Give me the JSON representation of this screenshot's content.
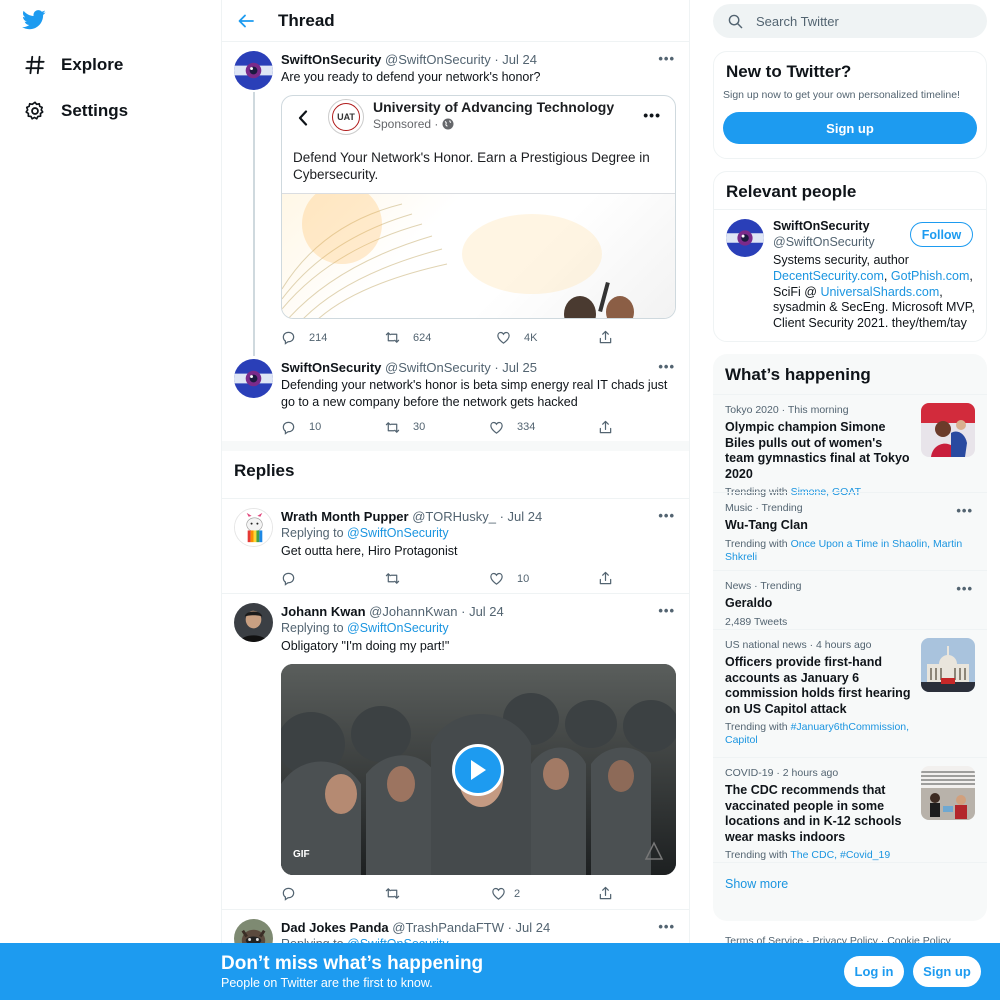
{
  "nav": {
    "explore": "Explore",
    "settings": "Settings"
  },
  "header": {
    "title": "Thread"
  },
  "main_tweet": {
    "name": "SwiftOnSecurity",
    "handle": "@SwiftOnSecurity",
    "date": "· Jul 24",
    "text": "Are you ready to defend your network's honor?",
    "card": {
      "advertiser": "University of Advancing Technology",
      "sponsored": "Sponsored ·",
      "logo_text": "UAT",
      "body": "Defend Your Network's Honor. Earn a Prestigious Degree in Cybersecurity."
    },
    "replies": "214",
    "retweets": "624",
    "likes": "4K"
  },
  "second_tweet": {
    "name": "SwiftOnSecurity",
    "handle": "@SwiftOnSecurity",
    "date": "· Jul 25",
    "text": "Defending your network's honor is beta simp energy real IT chads just go to a new company before the network gets hacked",
    "replies": "10",
    "retweets": "30",
    "likes": "334"
  },
  "replies_title": "Replies",
  "replies": [
    {
      "name": "Wrath Month Pupper",
      "handle": "@TORHusky_",
      "date": "· Jul 24",
      "replying_label": "Replying to",
      "replying_to": "@SwiftOnSecurity",
      "text": "Get outta here, Hiro Protagonist",
      "replies": "",
      "retweets": "",
      "likes": "10"
    },
    {
      "name": "Johann Kwan",
      "handle": "@JohannKwan",
      "date": "· Jul 24",
      "replying_label": "Replying to",
      "replying_to": "@SwiftOnSecurity",
      "text": "Obligatory \"I'm doing my part!\"",
      "gif_label": "GIF",
      "replies": "",
      "retweets": "",
      "likes": "2"
    },
    {
      "name": "Dad Jokes Panda",
      "handle": "@TrashPandaFTW",
      "date": "· Jul 24",
      "replying_label": "Replying to",
      "replying_to": "@SwiftOnSecurity"
    }
  ],
  "search": {
    "placeholder": "Search Twitter"
  },
  "new_to_twitter": {
    "title": "New to Twitter?",
    "subtitle": "Sign up now to get your own personalized timeline!",
    "button": "Sign up"
  },
  "relevant_people": {
    "title": "Relevant people",
    "name": "SwiftOnSecurity",
    "handle": "@SwiftOnSecurity",
    "follow": "Follow",
    "bio_1": "Systems security, author",
    "link_1": "DecentSecurity.com",
    "sep_1": ",",
    "link_2": "GotPhish.com",
    "sep_2": ",",
    "bio_2": "SciFi @",
    "link_3": "UniversalShards.com",
    "sep_3": ",",
    "bio_3": "sysadmin & SecEng. Microsoft MVP, Client Security 2021. they/them/tay"
  },
  "whats_happening": {
    "title": "What’s happening",
    "trends": [
      {
        "category": "Tokyo 2020 · This morning",
        "title": "Olympic champion Simone Biles pulls out of women's team gymnastics final at Tokyo 2020",
        "trending_label": "Trending with",
        "trending_with": "Simone, GOAT"
      },
      {
        "category": "Music · Trending",
        "title": "Wu-Tang Clan",
        "trending_label": "Trending with",
        "trending_with_1": "Once Upon a Time in Shaolin, Martin",
        "trending_with_2": "Shkreli"
      },
      {
        "category": "News · Trending",
        "title": "Geraldo",
        "count": "2,489 Tweets"
      },
      {
        "category": "US national news · 4 hours ago",
        "title": "Officers provide first-hand accounts as January 6 commission holds first hearing on US Capitol attack",
        "trending_label": "Trending with",
        "trending_with_1": "#January6thCommission,",
        "trending_with_2": "Capitol"
      },
      {
        "category": "COVID-19 · 2 hours ago",
        "title": "The CDC recommends that vaccinated people in some locations and in K-12 schools wear masks indoors",
        "trending_label": "Trending with",
        "trending_with": "The CDC, #Covid_19"
      }
    ],
    "show_more": "Show more"
  },
  "footer_links": "Terms of Service · Privacy Policy · Cookie Policy",
  "bottom_bar": {
    "headline": "Don’t miss what’s happening",
    "sub": "People on Twitter are the first to know.",
    "login": "Log in",
    "signup": "Sign up"
  },
  "colors": {
    "accent": "#1d9bf0",
    "text": "#0f1419",
    "secondary": "#536471"
  }
}
